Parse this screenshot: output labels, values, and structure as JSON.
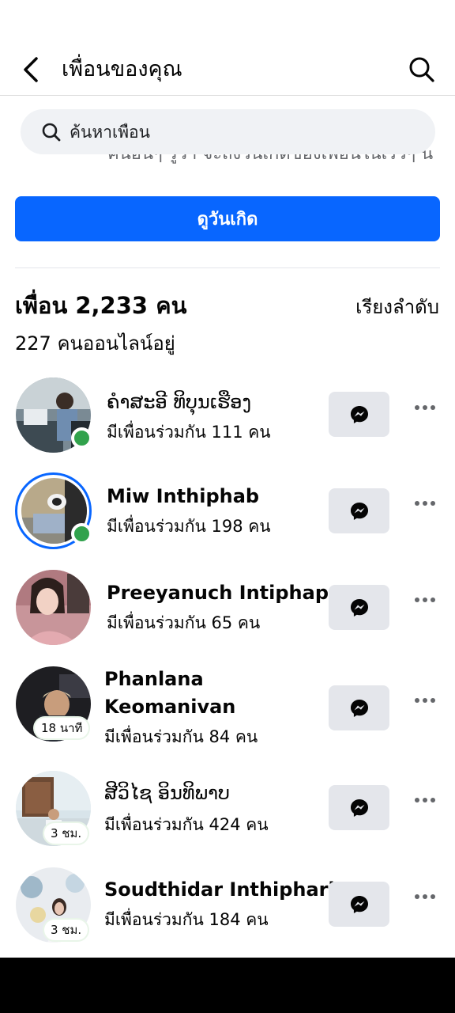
{
  "header": {
    "title": "เพื่อนของคุณ",
    "back_icon": "back-arrow-icon",
    "search_icon": "search-icon"
  },
  "search": {
    "placeholder": "ค้นหาเพื่อน"
  },
  "clipped_text": "คนอื่นๆ รู้ว่า จะถึงวันเกิดของเพื่อนในเร็วๆ นี้",
  "birthday_button": "ดูวันเกิด",
  "friends_section": {
    "count_title": "เพื่อน 2,233 คน",
    "sort_label": "เรียงลำดับ",
    "online_count": "227 คนออนไลน์อยู่"
  },
  "friends": [
    {
      "name": "ຄຳສະອີ ທິບຸນເຮືອງ",
      "mutual": "มีเพื่อนร่วมกัน 111 คน",
      "online": true
    },
    {
      "name": "Miw Inthiphab",
      "mutual": "มีเพื่อนร่วมกัน 198 คน",
      "online": true,
      "story_ring": true
    },
    {
      "name": "Preeyanuch Intiphap",
      "mutual": "มีเพื่อนร่วมกัน 65 คน"
    },
    {
      "name_line1": "Phanlana",
      "name_line2": "Keomanivan",
      "mutual": "มีเพื่อนร่วมกัน 84 คน",
      "last_active": "18 นาที"
    },
    {
      "name": "ສີວິໄຊ ອິນທິພາບ",
      "mutual": "มีเพื่อนร่วมกัน 424 คน",
      "last_active": "3 ชม."
    },
    {
      "name": "Soudthidar Inthipharb",
      "mutual": "มีเพื่อนร่วมกัน 184 คน",
      "last_active": "3 ชม."
    }
  ],
  "colors": {
    "accent": "#0866ff",
    "online": "#31a24c",
    "button_gray": "#e4e6eb"
  }
}
